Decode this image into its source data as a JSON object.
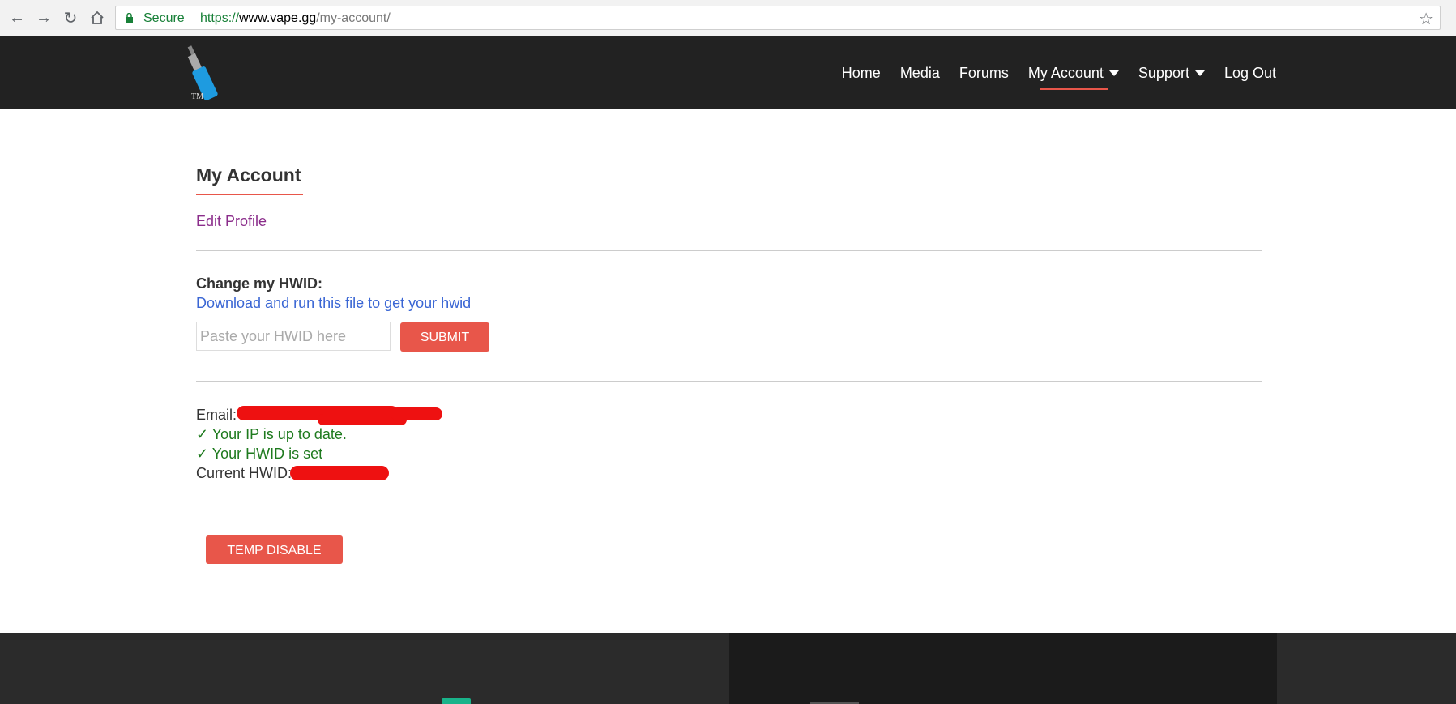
{
  "browser": {
    "back_icon": "arrow-left",
    "forward_icon": "arrow-right",
    "reload_icon": "reload",
    "home_icon": "home",
    "secure_label": "Secure",
    "url_scheme": "https://",
    "url_host": "www.vape.gg",
    "url_path": "/my-account/",
    "bookmark_icon": "star"
  },
  "header": {
    "logo_text": "TM",
    "menu": [
      {
        "label": "Home"
      },
      {
        "label": "Media"
      },
      {
        "label": "Forums"
      },
      {
        "label": "My Account",
        "dropdown": true,
        "active": true
      },
      {
        "label": "Support",
        "dropdown": true
      },
      {
        "label": "Log Out"
      }
    ]
  },
  "account": {
    "title": "My Account",
    "edit_profile": "Edit Profile",
    "hwid_heading": "Change my HWID:",
    "download_link": "Download and run this file to get your hwid",
    "hwid_placeholder": "Paste your HWID here",
    "submit_label": "SUBMIT",
    "email_label": "Email:",
    "ip_status": "✓ Your IP is up to date.",
    "hwid_status": "✓ Your HWID is set",
    "current_hwid_label": "Current HWID:",
    "temp_disable_label": "TEMP DISABLE"
  },
  "colors": {
    "accent": "#e8564a",
    "header_bg": "#222222",
    "link_visited": "#8b2d8b",
    "link": "#3a66d4",
    "success": "#1e7a1e",
    "redaction": "#ee1111"
  }
}
